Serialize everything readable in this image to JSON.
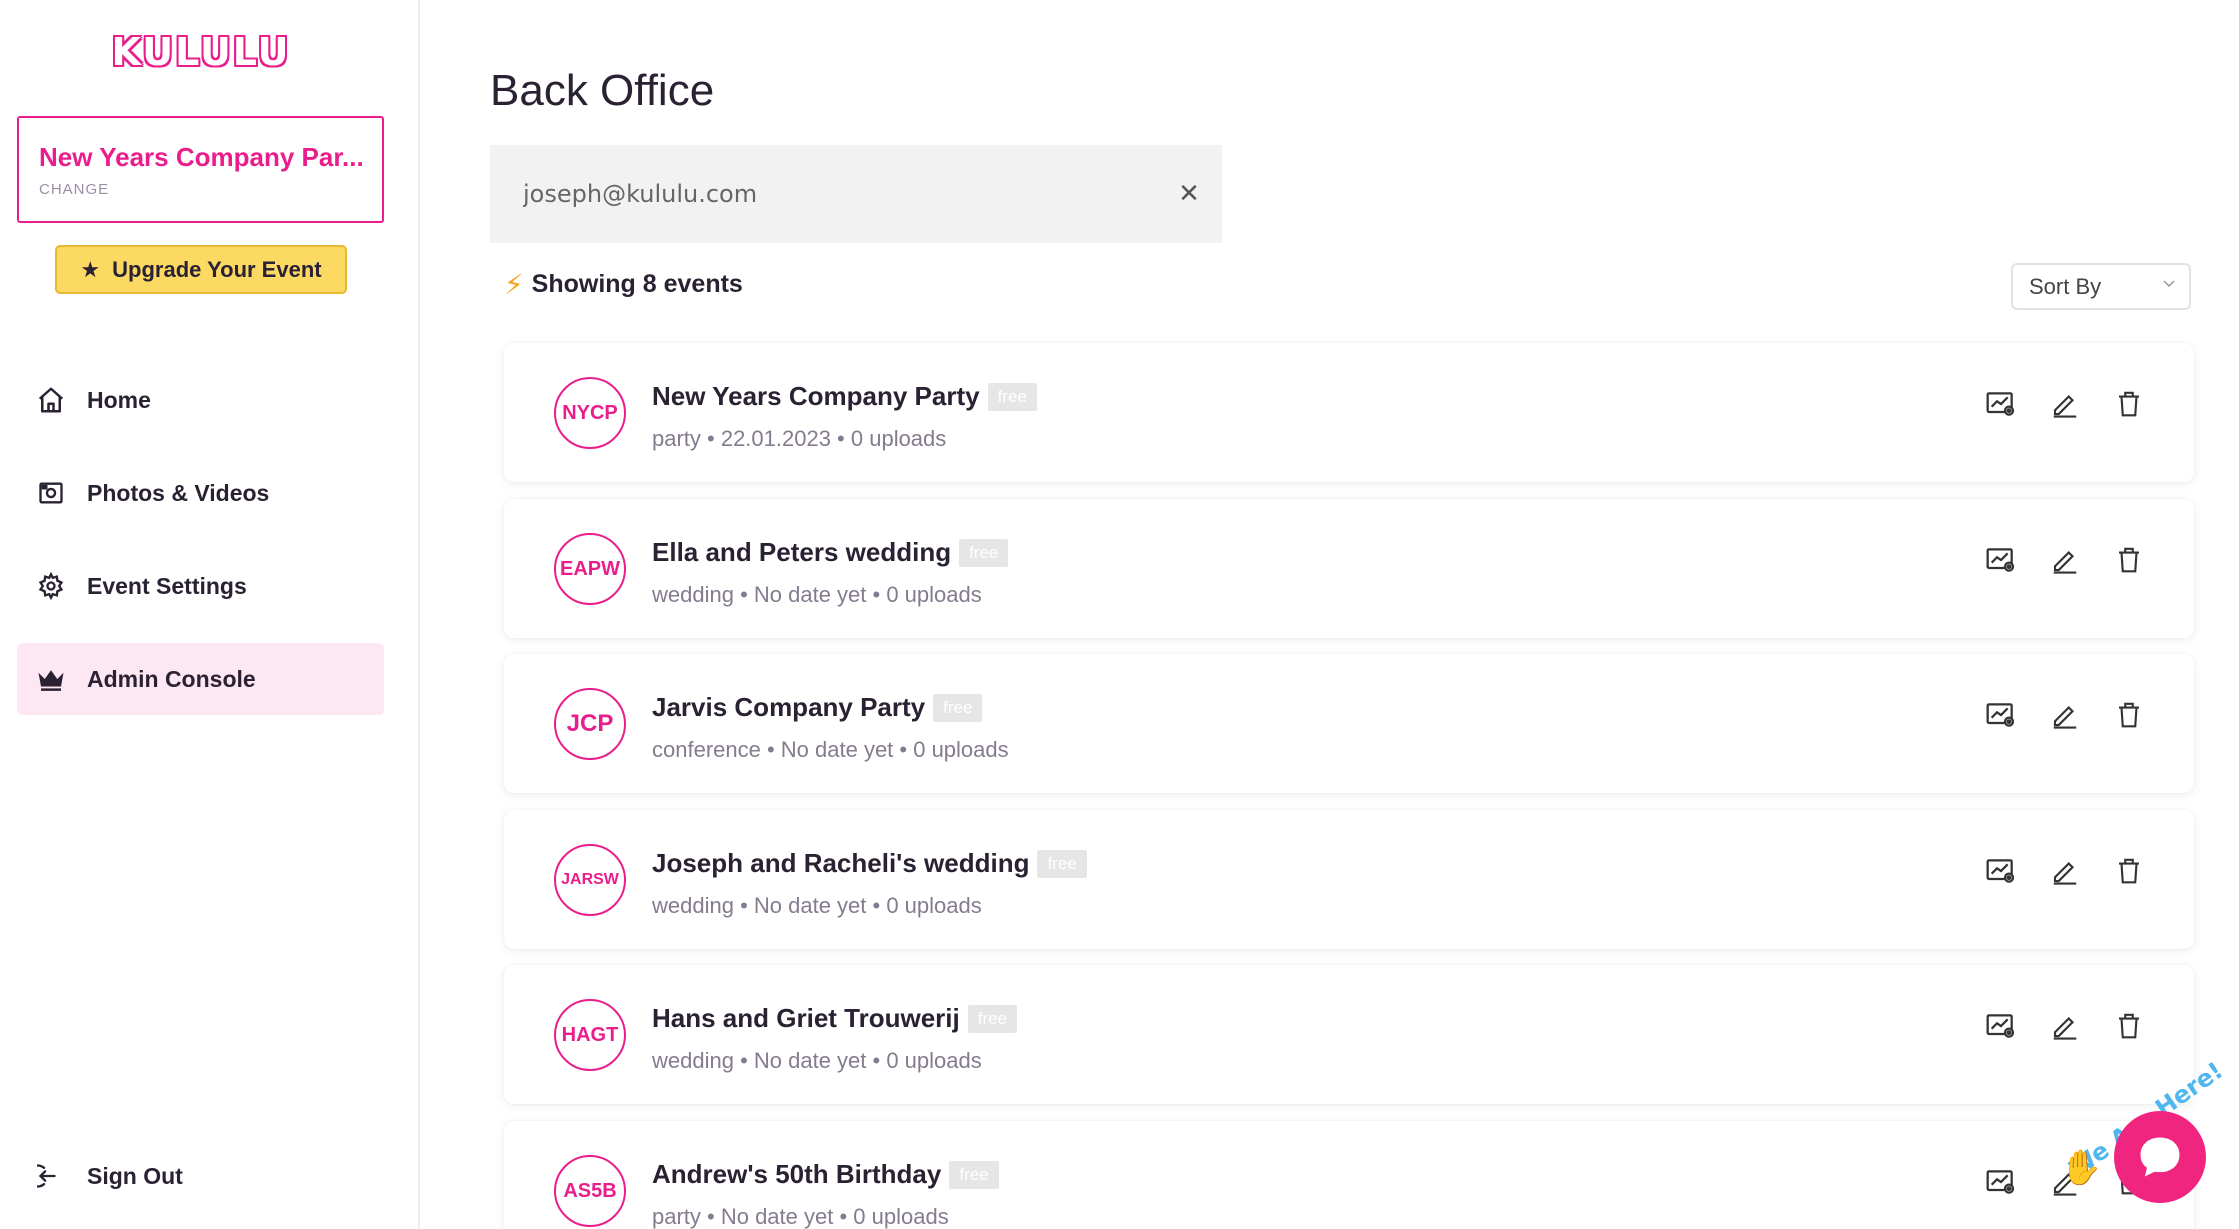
{
  "app": {
    "logo_text": "KULULU"
  },
  "sidebar": {
    "current_event": {
      "name": "New Years Company Par...",
      "change_label": "CHANGE"
    },
    "upgrade_label": "Upgrade Your Event",
    "nav": [
      {
        "label": "Home",
        "icon": "home-icon"
      },
      {
        "label": "Photos & Videos",
        "icon": "camera-icon"
      },
      {
        "label": "Event Settings",
        "icon": "gear-icon"
      },
      {
        "label": "Admin Console",
        "icon": "crown-icon",
        "active": true
      }
    ],
    "sign_out_label": "Sign Out"
  },
  "main": {
    "title": "Back Office",
    "search": {
      "value": "joseph@kululu.com"
    },
    "showing_text": "Showing 8 events",
    "sort_label": "Sort By",
    "events": [
      {
        "initials": "NYCP",
        "name": "New Years Company Party",
        "badge": "free",
        "meta": "party • 22.01.2023 • 0 uploads"
      },
      {
        "initials": "EAPW",
        "name": "Ella and Peters wedding",
        "badge": "free",
        "meta": "wedding • No date yet • 0 uploads"
      },
      {
        "initials": "JCP",
        "name": "Jarvis Company Party",
        "badge": "free",
        "meta": "conference • No date yet • 0 uploads"
      },
      {
        "initials": "JARSW",
        "name": "Joseph and Racheli's wedding",
        "badge": "free",
        "meta": "wedding • No date yet • 0 uploads"
      },
      {
        "initials": "HAGT",
        "name": "Hans and Griet Trouwerij",
        "badge": "free",
        "meta": "wedding • No date yet • 0 uploads"
      },
      {
        "initials": "AS5B",
        "name": "Andrew's 50th Birthday",
        "badge": "free",
        "meta": "party • No date yet • 0 uploads"
      }
    ]
  },
  "chat_widget": {
    "text": "We Are Here!"
  },
  "colors": {
    "brand": "#e91e8c",
    "upgrade": "#fbd962",
    "active_nav": "#fde7f2",
    "chat": "#f0257f"
  }
}
